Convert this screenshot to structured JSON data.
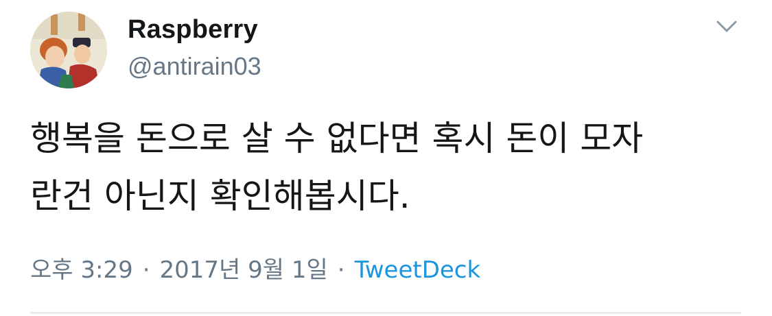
{
  "tweet": {
    "author": {
      "display_name": "Raspberry",
      "handle": "@antirain03",
      "avatar": "medieval-portrait-avatar"
    },
    "menu_icon": "chevron-down-icon",
    "text_lines": [
      "행복을 돈으로 살 수 없다면 혹시 돈이 모자",
      "란건 아닌지 확인해봅시다."
    ],
    "timestamp": "오후 3:29",
    "date": "2017년 9월 1일",
    "separator": "·",
    "source": "TweetDeck"
  },
  "colors": {
    "text": "#14171a",
    "secondary": "#657786",
    "link": "#1b95e0",
    "divider": "#e6ecf0"
  }
}
